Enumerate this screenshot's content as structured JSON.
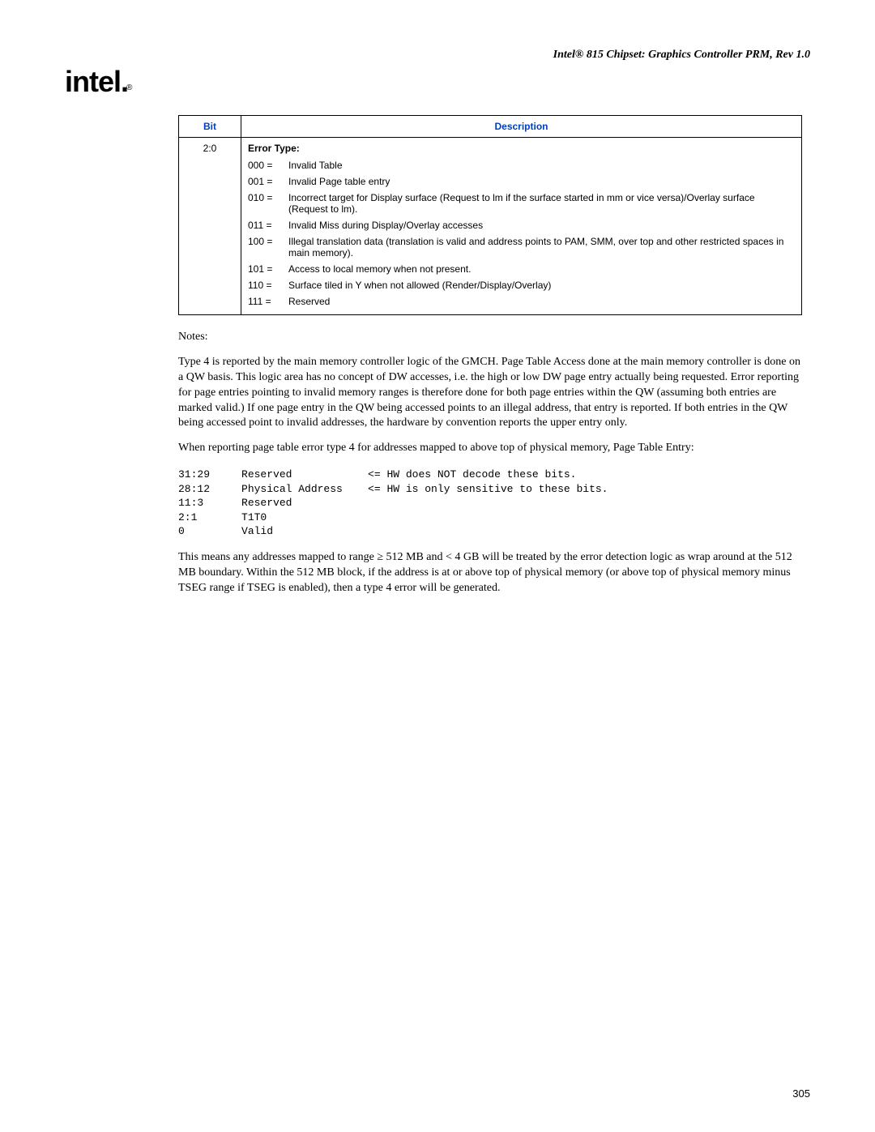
{
  "header": {
    "title": "Intel® 815 Chipset: Graphics Controller PRM, Rev 1.0"
  },
  "logo": {
    "text": "intel",
    "sub": "®"
  },
  "table": {
    "headers": {
      "bit": "Bit",
      "desc": "Description"
    },
    "row": {
      "bit": "2:0",
      "label": "Error Type:",
      "items": [
        {
          "code": "000 =",
          "text": "Invalid Table"
        },
        {
          "code": "001 =",
          "text": "Invalid Page table entry"
        },
        {
          "code": "010 =",
          "text": "Incorrect target for Display surface (Request to lm if the surface started in mm or vice versa)/Overlay surface (Request to lm)."
        },
        {
          "code": "011 =",
          "text": "Invalid Miss during Display/Overlay accesses"
        },
        {
          "code": "100 =",
          "text": "Illegal translation data (translation is valid and address points to PAM, SMM, over top and other restricted spaces in main memory)."
        },
        {
          "code": "101 =",
          "text": "Access to local memory when not present."
        },
        {
          "code": "110 =",
          "text": "Surface tiled in Y when not allowed (Render/Display/Overlay)"
        },
        {
          "code": "111 =",
          "text": "Reserved"
        }
      ]
    }
  },
  "notes": {
    "heading": "Notes:",
    "p1": "Type 4 is reported by the main memory controller logic of the GMCH. Page Table Access done at the main memory controller is done on a QW basis. This logic area has no concept of DW accesses, i.e. the high or low DW page entry actually being requested. Error reporting for page entries pointing to invalid memory ranges is therefore done for both page entries within the QW (assuming both entries are marked valid.) If one page entry in the QW being accessed points to an illegal address, that entry is reported. If both entries in the QW being accessed point to invalid addresses, the hardware by convention reports the upper entry only.",
    "p2": "When reporting page table error type 4 for addresses mapped to above top of physical memory, Page Table Entry:",
    "mono": "31:29     Reserved            <= HW does NOT decode these bits.\n28:12     Physical Address    <= HW is only sensitive to these bits.\n11:3      Reserved\n2:1       T1T0\n0         Valid",
    "p3": "This means any addresses mapped to range ≥ 512 MB and < 4 GB will be treated by the error detection logic as wrap around at the 512 MB boundary. Within the 512 MB block, if the address is at or above top of physical memory (or above top of physical memory minus TSEG range if TSEG is enabled), then a type 4 error will be generated."
  },
  "page_number": "305"
}
